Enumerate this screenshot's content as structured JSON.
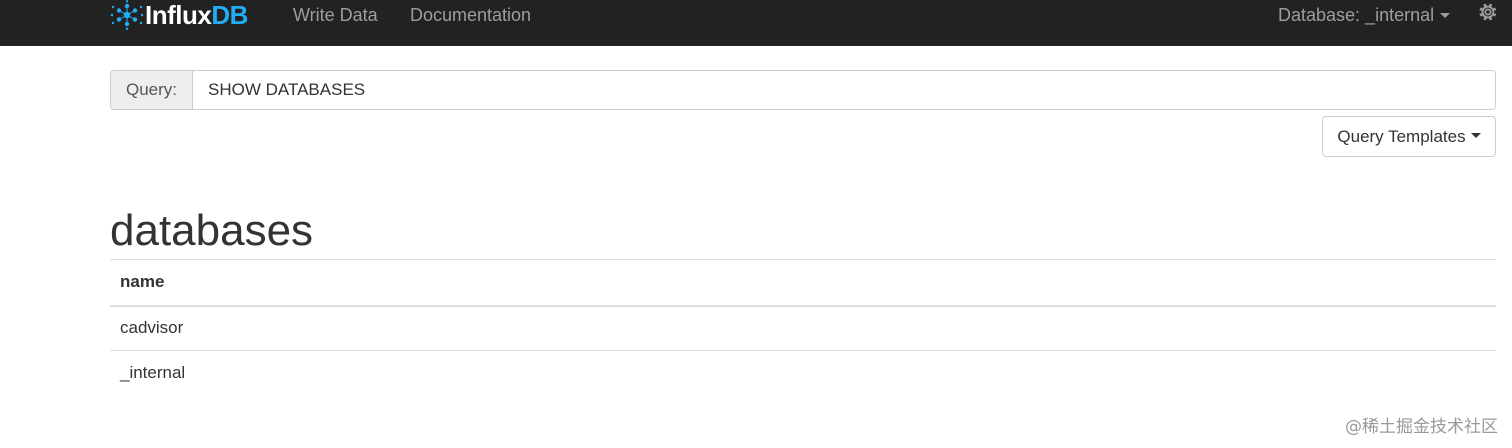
{
  "navbar": {
    "brand": {
      "part1": "Influx",
      "part2": "DB"
    },
    "links": [
      {
        "label": "Write Data"
      },
      {
        "label": "Documentation"
      }
    ],
    "database_dropdown": {
      "label": "Database: _internal"
    },
    "settings_icon": "gear-icon"
  },
  "query": {
    "addon_label": "Query:",
    "value": "SHOW DATABASES"
  },
  "templates_button": {
    "label": "Query Templates"
  },
  "result": {
    "title": "databases",
    "columns": [
      "name"
    ],
    "rows": [
      [
        "cadvisor"
      ],
      [
        "_internal"
      ]
    ]
  },
  "watermark": "@稀土掘金技术社区",
  "colors": {
    "navbar_bg": "#222222",
    "brand_accent": "#22adf6",
    "nav_text": "#9d9d9d"
  }
}
